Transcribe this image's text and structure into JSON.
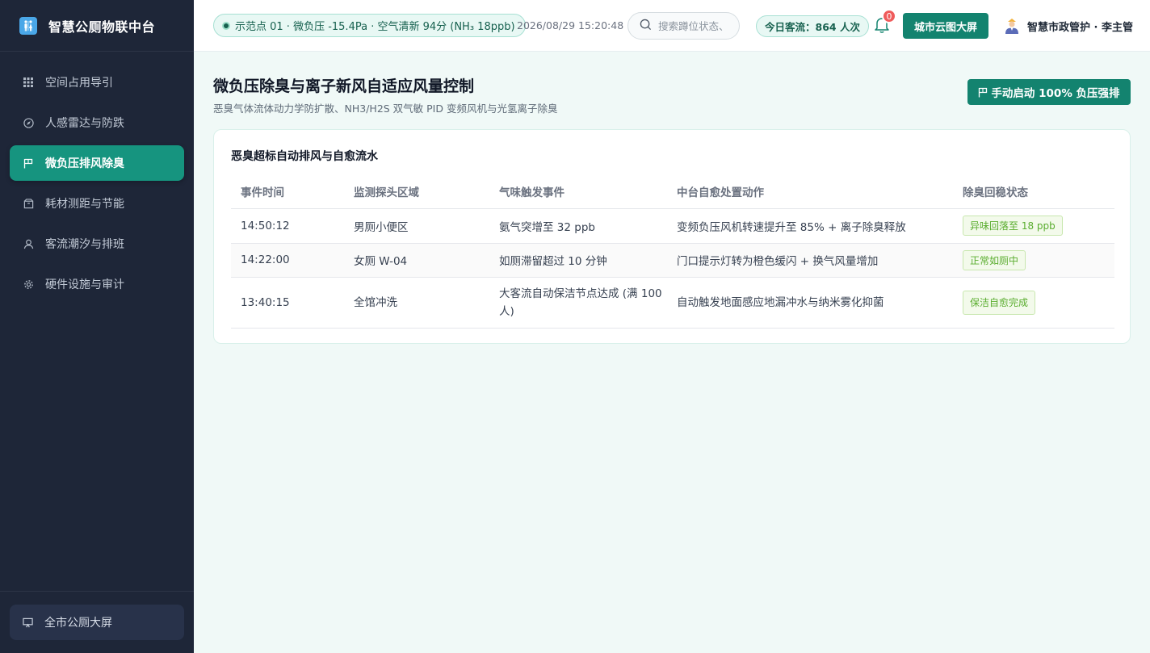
{
  "app": {
    "title": "智慧公厕物联中台"
  },
  "sidebar": {
    "items": [
      {
        "label": "空间占用导引",
        "icon": "grid-icon"
      },
      {
        "label": "人感雷达与防跌",
        "icon": "compass-icon"
      },
      {
        "label": "微负压排风除臭",
        "icon": "flag-icon",
        "active": true
      },
      {
        "label": "耗材测距与节能",
        "icon": "box-icon"
      },
      {
        "label": "客流潮汐与排班",
        "icon": "user-icon"
      },
      {
        "label": "硬件设施与审计",
        "icon": "gear-icon"
      }
    ],
    "footer_label": "全市公厕大屏"
  },
  "topbar": {
    "status": "示范点 01 · 微负压 -15.4Pa · 空气清新 94分 (NH₃ 18ppb)",
    "datetime": "2026/08/29 15:20:48",
    "search_placeholder": "搜索蹲位状态、",
    "traffic": "今日客流：864 人次",
    "notification_count": "0",
    "map_button": "城市云图大屏",
    "user": "智慧市政管护 · 李主管"
  },
  "page": {
    "title": "微负压除臭与离子新风自适应风量控制",
    "subtitle": "恶臭气体流体动力学防扩散、NH3/H2S 双气敏 PID 变频风机与光氢离子除臭",
    "force_button": "手动启动 100% 负压强排"
  },
  "table": {
    "title": "恶臭超标自动排风与自愈流水",
    "headers": [
      "事件时间",
      "监测探头区域",
      "气味触发事件",
      "中台自愈处置动作",
      "除臭回稳状态"
    ],
    "rows": [
      {
        "time": "14:50:12",
        "area": "男厕小便区",
        "event": "氨气突增至 32 ppb",
        "action": "变频负压风机转速提升至 85% + 离子除臭释放",
        "status": "异味回落至 18 ppb"
      },
      {
        "time": "14:22:00",
        "area": "女厕 W-04",
        "event": "如厕滞留超过 10 分钟",
        "action": "门口提示灯转为橙色缓闪 + 换气风量增加",
        "status": "正常如厕中"
      },
      {
        "time": "13:40:15",
        "area": "全馆冲洗",
        "event": "大客流自动保洁节点达成 (满 100人)",
        "action": "自动触发地面感应地漏冲水与纳米雾化抑菌",
        "status": "保洁自愈完成"
      }
    ]
  },
  "colors": {
    "sidebar_bg": "#1e2638",
    "accent": "#13836f",
    "active_nav": "#16947f",
    "status_tag_text": "#5aad2f",
    "badge": "#ef5b5b"
  }
}
